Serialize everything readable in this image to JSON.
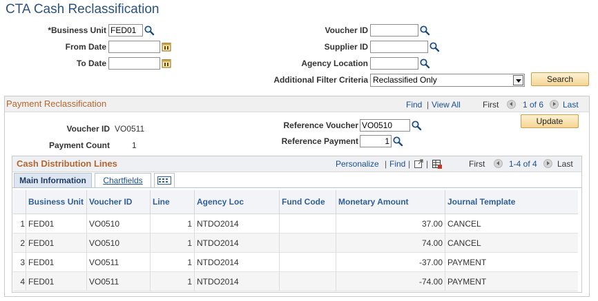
{
  "page": {
    "title": "CTA Cash Reclassification"
  },
  "search": {
    "business_unit": {
      "label": "*Business Unit",
      "value": "FED01"
    },
    "from_date": {
      "label": "From Date",
      "value": ""
    },
    "to_date": {
      "label": "To Date",
      "value": ""
    },
    "voucher_id": {
      "label": "Voucher ID",
      "value": ""
    },
    "supplier_id": {
      "label": "Supplier ID",
      "value": ""
    },
    "agency_location": {
      "label": "Agency Location",
      "value": ""
    },
    "filter": {
      "label": "Additional Filter Criteria",
      "value": "Reclassified Only"
    },
    "search_button": "Search"
  },
  "payment": {
    "title": "Payment Reclassification",
    "find": "Find",
    "sep": "|",
    "view_all": "View All",
    "first": "First",
    "counter": "1 of 6",
    "last": "Last",
    "voucher_id_label": "Voucher ID",
    "voucher_id_value": "VO0511",
    "payment_count_label": "Payment Count",
    "payment_count_value": "1",
    "ref_voucher_label": "Reference Voucher",
    "ref_voucher_value": "VO0510",
    "ref_payment_label": "Reference Payment",
    "ref_payment_value": "1",
    "update_button": "Update"
  },
  "grid": {
    "title": "Cash Distribution Lines",
    "personalize": "Personalize",
    "find": "Find",
    "sep": "|",
    "first": "First",
    "counter": "1-4 of 4",
    "last": "Last",
    "tabs": {
      "main": "Main Information",
      "chartfields": "Chartfields"
    },
    "columns": [
      "Business Unit",
      "Voucher ID",
      "Line",
      "Agency Loc",
      "Fund Code",
      "Monetary Amount",
      "Journal Template"
    ],
    "rows": [
      {
        "n": "1",
        "bu": "FED01",
        "voucher": "VO0510",
        "line": "1",
        "agency": "NTDO2014",
        "fund": "",
        "amount": "37.00",
        "template": "CANCEL"
      },
      {
        "n": "2",
        "bu": "FED01",
        "voucher": "VO0510",
        "line": "1",
        "agency": "NTDO2014",
        "fund": "",
        "amount": "74.00",
        "template": "CANCEL"
      },
      {
        "n": "3",
        "bu": "FED01",
        "voucher": "VO0511",
        "line": "1",
        "agency": "NTDO2014",
        "fund": "",
        "amount": "-37.00",
        "template": "PAYMENT"
      },
      {
        "n": "4",
        "bu": "FED01",
        "voucher": "VO0511",
        "line": "1",
        "agency": "NTDO2014",
        "fund": "",
        "amount": "-74.00",
        "template": "PAYMENT"
      }
    ]
  },
  "colors": {
    "title": "#2b5282",
    "section": "#b5662f",
    "link": "#1a4f95",
    "button": "#f5d594"
  }
}
